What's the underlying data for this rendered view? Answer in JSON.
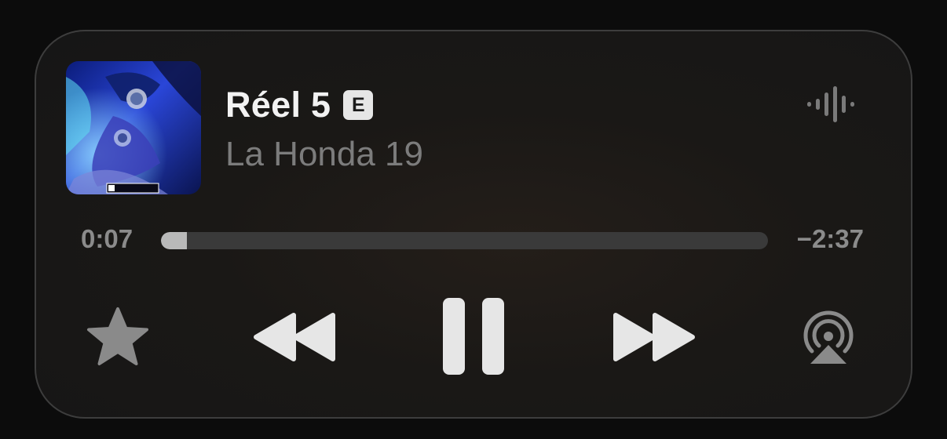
{
  "track": {
    "title": "Réel 5",
    "explicit_label": "E",
    "artist": "La Honda 19"
  },
  "progress": {
    "elapsed": "0:07",
    "remaining": "−2:37",
    "fraction": 0.043
  },
  "icons": {
    "waveform": "waveform-icon",
    "favorite": "star-icon",
    "previous": "rewind-icon",
    "play_pause": "pause-icon",
    "next": "fast-forward-icon",
    "airplay": "airplay-icon"
  },
  "colors": {
    "accent_light": "#e6e6e6",
    "muted": "#7c7c7c",
    "progress_track": "#3a3a3a",
    "progress_fill": "#b9b9b9"
  }
}
